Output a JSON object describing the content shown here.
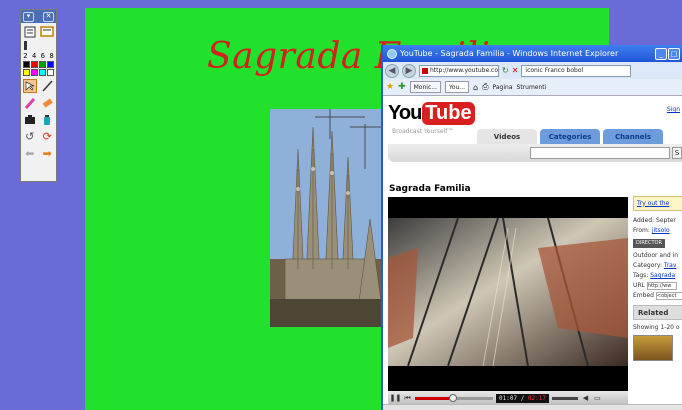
{
  "toolbar": {
    "widths": [
      "2",
      "4",
      "6",
      "8"
    ],
    "colors": [
      "#000000",
      "#ff0000",
      "#00a000",
      "#0000ff",
      "#ffff00",
      "#ff00ff",
      "#00ffff",
      "#ffffff"
    ]
  },
  "slide": {
    "title": "Sagrada Familia"
  },
  "ie": {
    "window_title": "YouTube - Sagrada Familia - Windows Internet Explorer",
    "url": "http://www.youtube.com/watch",
    "search": "iconic Franco bobol",
    "tabs": [
      "Monic...",
      "You..."
    ],
    "menu_page": "Pagina",
    "menu_tools": "Strumenti"
  },
  "youtube": {
    "logo_you": "You",
    "logo_tube": "Tube",
    "slogan": "Broadcast Yourself™",
    "sign_in": "Sign",
    "nav": [
      "Videos",
      "Categories",
      "Channels"
    ],
    "video_title": "Sagrada Familia",
    "time_current": "01:07",
    "time_total": "02:17",
    "progress_fraction": 0.49,
    "try_out": "Try out the",
    "added": "Added: Septer",
    "from_label": "From:",
    "from_user": "jitsolo",
    "director": "DIRECTOR",
    "tags_text": "Outdoor and in",
    "category_label": "Category:",
    "category_value": "Trav",
    "tags_label": "Tags:",
    "tags_value": "Sagrada",
    "url_label": "URL",
    "url_value": "http://ww",
    "embed_label": "Embed",
    "embed_value": "<object",
    "related": "Related",
    "showing": "Showing 1-20 o"
  }
}
